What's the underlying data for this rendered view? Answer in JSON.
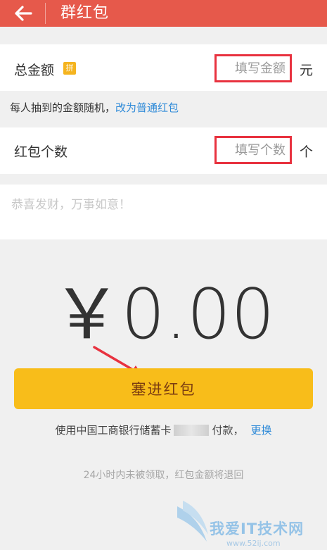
{
  "header": {
    "title": "群红包",
    "back_icon": "arrow-left-icon",
    "bg_color": "#e6594b"
  },
  "amount_row": {
    "label": "总金额",
    "badge": "拼",
    "placeholder": "填写金额",
    "unit": "元"
  },
  "note": {
    "text": "每人抽到的金额随机，",
    "link": "改为普通红包"
  },
  "count_row": {
    "label": "红包个数",
    "placeholder": "填写个数",
    "unit": "个"
  },
  "message": {
    "placeholder": "恭喜发财，万事如意！"
  },
  "total": {
    "display": "￥0.00"
  },
  "submit": {
    "label": "塞进红包",
    "color": "#f8bd1a"
  },
  "payment": {
    "prefix": "使用中国工商银行储蓄卡",
    "suffix": "付款，",
    "change_link": "更换"
  },
  "footer_note": "24小时内未被领取，红包金额将退回",
  "watermark": {
    "text": "我爱IT技术网",
    "url": "www.52ij.com"
  },
  "colors": {
    "highlight_border": "#e8323f",
    "link": "#2e8ad8"
  }
}
